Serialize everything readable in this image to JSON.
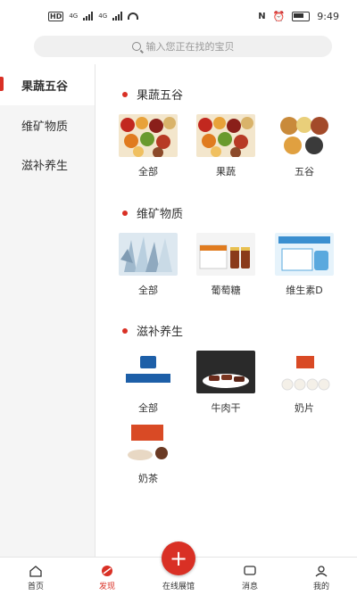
{
  "status": {
    "hd": "HD",
    "signal1": "4G",
    "signal2": "4G",
    "time": "9:49"
  },
  "search": {
    "placeholder": "输入您正在找的宝贝"
  },
  "sidebar": {
    "items": [
      {
        "label": "果蔬五谷",
        "active": true
      },
      {
        "label": "维矿物质",
        "active": false
      },
      {
        "label": "滋补养生",
        "active": false
      }
    ]
  },
  "sections": [
    {
      "title": "果蔬五谷",
      "items": [
        {
          "label": "全部"
        },
        {
          "label": "果蔬"
        },
        {
          "label": "五谷"
        }
      ]
    },
    {
      "title": "维矿物质",
      "items": [
        {
          "label": "全部"
        },
        {
          "label": "葡萄糖"
        },
        {
          "label": "维生素D"
        }
      ]
    },
    {
      "title": "滋补养生",
      "items": [
        {
          "label": "全部"
        },
        {
          "label": "牛肉干"
        },
        {
          "label": "奶片"
        },
        {
          "label": "奶茶"
        }
      ]
    }
  ],
  "tabbar": {
    "items": [
      {
        "label": "首页",
        "icon": "home-icon"
      },
      {
        "label": "发现",
        "icon": "discover-icon"
      },
      {
        "label": "在线展馆",
        "icon": "plus-icon"
      },
      {
        "label": "消息",
        "icon": "message-icon"
      },
      {
        "label": "我的",
        "icon": "profile-icon"
      }
    ]
  },
  "colors": {
    "accent": "#d93025",
    "sidebar_bg": "#f5f5f5"
  }
}
